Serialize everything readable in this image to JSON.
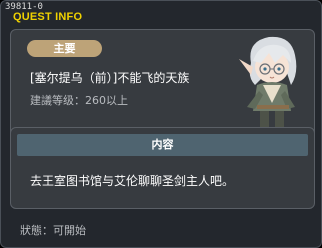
{
  "window": {
    "quest_id": "39811-0",
    "header_title": "QUEST INFO"
  },
  "quest": {
    "badge": "主要",
    "title": "[塞尔提乌（前）]不能飞的天族",
    "level": "建議等级：260以上",
    "npc_icon": "elf-npc-portrait"
  },
  "content": {
    "header": "内容",
    "text": "去王室图书馆与艾伦聊聊圣剑主人吧。"
  },
  "status": {
    "text": "狀態：可開始"
  },
  "colors": {
    "title_yellow": "#f0d200",
    "badge_tan": "#bda378",
    "content_bar": "#4f6470",
    "panel": "#373b40",
    "window": "#23272d"
  }
}
